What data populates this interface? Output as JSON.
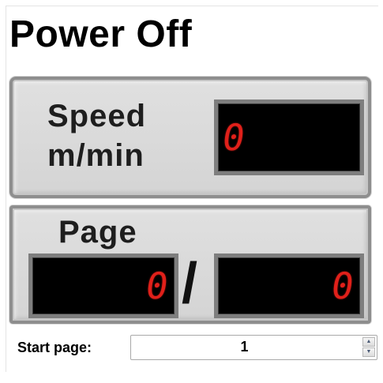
{
  "status": {
    "title": "Power Off"
  },
  "speed": {
    "label_line1": "Speed",
    "label_line2": "m/min",
    "value": "0"
  },
  "page": {
    "label": "Page",
    "current": "0",
    "separator": "/",
    "total": "0"
  },
  "start_page": {
    "label": "Start page:",
    "value": "1"
  },
  "colors": {
    "lcd_digit": "#e0201a",
    "lcd_background": "#000000",
    "panel": "#d8d8d8"
  },
  "icons": {
    "spin_up": "triangle-up",
    "spin_down": "triangle-down"
  }
}
